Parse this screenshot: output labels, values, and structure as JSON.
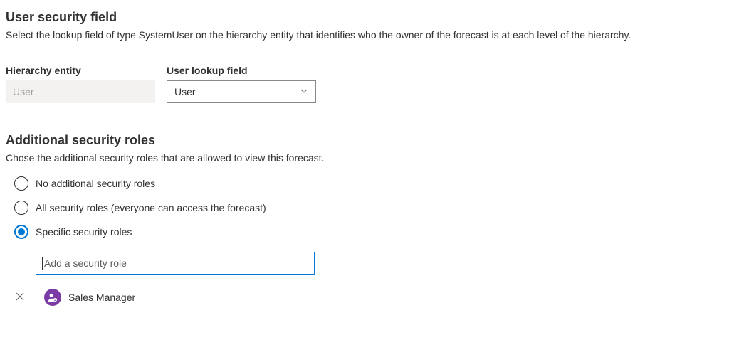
{
  "section1": {
    "title": "User security field",
    "desc": "Select the lookup field of type SystemUser on the hierarchy entity that identifies who the owner of the forecast is at each level of the hierarchy."
  },
  "fields": {
    "hierarchy": {
      "label": "Hierarchy entity",
      "value": "User"
    },
    "lookup": {
      "label": "User lookup field",
      "value": "User"
    }
  },
  "section2": {
    "title": "Additional security roles",
    "desc": "Chose the additional security roles that are allowed to view this forecast."
  },
  "radios": {
    "none": "No additional security roles",
    "all": "All security roles (everyone can access the forecast)",
    "specific": "Specific security roles"
  },
  "addRole": {
    "placeholder": "Add a security role"
  },
  "role": {
    "name": "Sales Manager"
  }
}
